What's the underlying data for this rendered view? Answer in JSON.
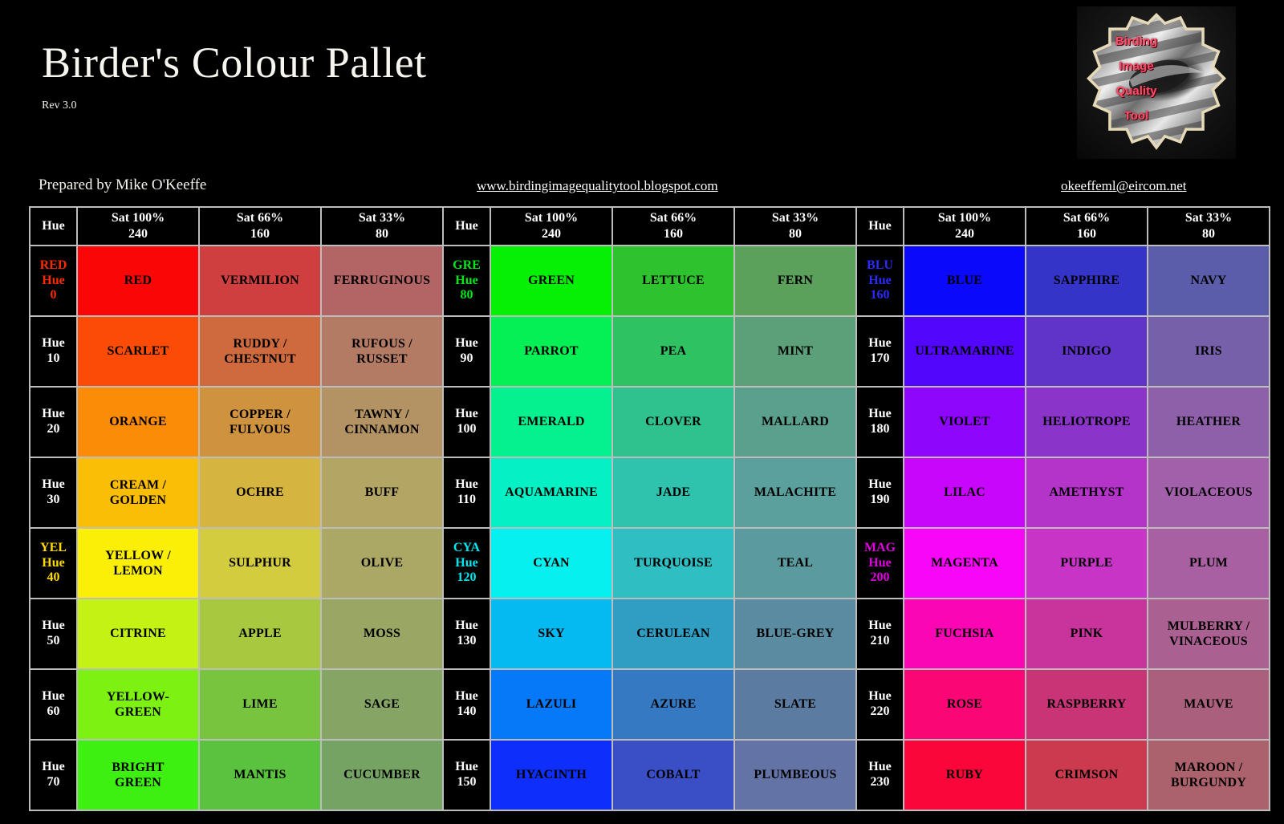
{
  "header": {
    "title": "Birder's Colour Pallet",
    "revision": "Rev 3.0",
    "prepared_by": "Prepared by Mike O'Keeffe",
    "blog_url": "www.birdingimagequalitytool.blogspot.com",
    "email": "okeeffeml@eircom.net"
  },
  "logo": {
    "name": "birding-image-quality-tool-logo",
    "words": [
      "Birding",
      "Image",
      "Quality",
      "Tool"
    ],
    "text_color": "#ff4d6a",
    "gear_outline_color": "#e6d9b8"
  },
  "table": {
    "headers": [
      "Hue",
      "Sat 100%",
      "240",
      "Sat 66%",
      "160",
      "Sat 33%",
      "80"
    ],
    "hue_header": "Hue",
    "sat_headers": [
      {
        "pct": "Sat 100%",
        "val": "240"
      },
      {
        "pct": "Sat 66%",
        "val": "160"
      },
      {
        "pct": "Sat 33%",
        "val": "80"
      }
    ]
  },
  "chart_data": {
    "type": "table",
    "title": "Birder's Colour Pallet",
    "description": "Colour naming reference grid: 24 hues (0-230 in steps of 10) x 3 saturation levels (240 = Sat 100%, 160 = Sat 66%, 80 = Sat 33%), laid out as three side-by-side blocks of 8 hue rows.",
    "columns": [
      "Hue",
      "Sat 100% / 240",
      "Sat 66% / 160",
      "Sat 33% / 80"
    ],
    "blocks": [
      {
        "block_index": 0,
        "rows": [
          {
            "hue_primary": "RED",
            "hue_label": "Hue",
            "hue_value": "0",
            "hue_label_color": "#ff2a00",
            "cells": [
              {
                "name": "RED",
                "color": "#fb0606"
              },
              {
                "name": "VERMILION",
                "color": "#d03f3f"
              },
              {
                "name": "FERRUGINOUS",
                "color": "#b36464"
              }
            ]
          },
          {
            "hue_primary": "",
            "hue_label": "Hue",
            "hue_value": "10",
            "hue_label_color": "#ffffff",
            "cells": [
              {
                "name": "SCARLET",
                "color": "#fb4b07"
              },
              {
                "name": "RUDDY / CHESTNUT",
                "color": "#cf6a3f"
              },
              {
                "name": "RUFOUS / RUSSET",
                "color": "#b37a64"
              }
            ]
          },
          {
            "hue_primary": "",
            "hue_label": "Hue",
            "hue_value": "20",
            "hue_label_color": "#ffffff",
            "cells": [
              {
                "name": "ORANGE",
                "color": "#fb8c07"
              },
              {
                "name": "COPPER / FULVOUS",
                "color": "#cf923f"
              },
              {
                "name": "TAWNY / CINNAMON",
                "color": "#b39264"
              }
            ]
          },
          {
            "hue_primary": "",
            "hue_label": "Hue",
            "hue_value": "30",
            "hue_label_color": "#ffffff",
            "cells": [
              {
                "name": "CREAM / GOLDEN",
                "color": "#fbbe07"
              },
              {
                "name": "OCHRE",
                "color": "#d5b53f"
              },
              {
                "name": "BUFF",
                "color": "#b3a564"
              }
            ]
          },
          {
            "hue_primary": "YEL",
            "hue_label": "Hue",
            "hue_value": "40",
            "hue_label_color": "#ffd900",
            "cells": [
              {
                "name": "YELLOW / LEMON",
                "color": "#fbee07"
              },
              {
                "name": "SULPHUR",
                "color": "#d4cc3f"
              },
              {
                "name": "OLIVE",
                "color": "#aba764"
              }
            ]
          },
          {
            "hue_primary": "",
            "hue_label": "Hue",
            "hue_value": "50",
            "hue_label_color": "#ffffff",
            "cells": [
              {
                "name": "CITRINE",
                "color": "#c4f215"
              },
              {
                "name": "APPLE",
                "color": "#a8c83f"
              },
              {
                "name": "MOSS",
                "color": "#9aa764"
              }
            ]
          },
          {
            "hue_primary": "",
            "hue_label": "Hue",
            "hue_value": "60",
            "hue_label_color": "#ffffff",
            "cells": [
              {
                "name": "YELLOW-GREEN",
                "color": "#7cf112"
              },
              {
                "name": "LIME",
                "color": "#79c43f"
              },
              {
                "name": "SAGE",
                "color": "#86a464"
              }
            ]
          },
          {
            "hue_primary": "",
            "hue_label": "Hue",
            "hue_value": "70",
            "hue_label_color": "#ffffff",
            "cells": [
              {
                "name": "BRIGHT GREEN",
                "color": "#3ef011"
              },
              {
                "name": "MANTIS",
                "color": "#5ac23f"
              },
              {
                "name": "CUCUMBER",
                "color": "#74a364"
              }
            ]
          }
        ]
      },
      {
        "block_index": 1,
        "rows": [
          {
            "hue_primary": "GRE",
            "hue_label": "Hue",
            "hue_value": "80",
            "hue_label_color": "#00e81b",
            "cells": [
              {
                "name": "GREEN",
                "color": "#05f005"
              },
              {
                "name": "LETTUCE",
                "color": "#2fc22f"
              },
              {
                "name": "FERN",
                "color": "#5ba05b"
              }
            ]
          },
          {
            "hue_primary": "",
            "hue_label": "Hue",
            "hue_value": "90",
            "hue_label_color": "#ffffff",
            "cells": [
              {
                "name": "PARROT",
                "color": "#05f055"
              },
              {
                "name": "PEA",
                "color": "#2fc263"
              },
              {
                "name": "MINT",
                "color": "#5ba078"
              }
            ]
          },
          {
            "hue_primary": "",
            "hue_label": "Hue",
            "hue_value": "100",
            "hue_label_color": "#ffffff",
            "cells": [
              {
                "name": "EMERALD",
                "color": "#05f08f"
              },
              {
                "name": "CLOVER",
                "color": "#2fc28f"
              },
              {
                "name": "MALLARD",
                "color": "#5ba08d"
              }
            ]
          },
          {
            "hue_primary": "",
            "hue_label": "Hue",
            "hue_value": "110",
            "hue_label_color": "#ffffff",
            "cells": [
              {
                "name": "AQUAMARINE",
                "color": "#05f0c4"
              },
              {
                "name": "JADE",
                "color": "#2fc2ad"
              },
              {
                "name": "MALACHITE",
                "color": "#5ba09d"
              }
            ]
          },
          {
            "hue_primary": "CYA",
            "hue_label": "Hue",
            "hue_value": "120",
            "hue_label_color": "#00e5ef",
            "cells": [
              {
                "name": "CYAN",
                "color": "#05f0ee"
              },
              {
                "name": "TURQUOISE",
                "color": "#2fbec2"
              },
              {
                "name": "TEAL",
                "color": "#5b9ba0"
              }
            ]
          },
          {
            "hue_primary": "",
            "hue_label": "Hue",
            "hue_value": "130",
            "hue_label_color": "#ffffff",
            "cells": [
              {
                "name": "SKY",
                "color": "#05baf0"
              },
              {
                "name": "CERULEAN",
                "color": "#2f9ec2"
              },
              {
                "name": "BLUE-GREY",
                "color": "#5b8ba0"
              }
            ]
          },
          {
            "hue_primary": "",
            "hue_label": "Hue",
            "hue_value": "140",
            "hue_label_color": "#ffffff",
            "cells": [
              {
                "name": "LAZULI",
                "color": "#0679f9"
              },
              {
                "name": "AZURE",
                "color": "#3479c2"
              },
              {
                "name": "SLATE",
                "color": "#5b7ca0"
              }
            ]
          },
          {
            "hue_primary": "",
            "hue_label": "Hue",
            "hue_value": "150",
            "hue_label_color": "#ffffff",
            "cells": [
              {
                "name": "HYACINTH",
                "color": "#0e2ffb"
              },
              {
                "name": "COBALT",
                "color": "#3a4fc5"
              },
              {
                "name": "PLUMBEOUS",
                "color": "#6373a6"
              }
            ]
          }
        ]
      },
      {
        "block_index": 2,
        "rows": [
          {
            "hue_primary": "BLU",
            "hue_label": "Hue",
            "hue_value": "160",
            "hue_label_color": "#2b2bff",
            "cells": [
              {
                "name": "BLUE",
                "color": "#0a09fb"
              },
              {
                "name": "SAPPHIRE",
                "color": "#3434c9"
              },
              {
                "name": "NAVY",
                "color": "#5c5daa"
              }
            ]
          },
          {
            "hue_primary": "",
            "hue_label": "Hue",
            "hue_value": "170",
            "hue_label_color": "#ffffff",
            "cells": [
              {
                "name": "ULTRAMARINE",
                "color": "#5206fb"
              },
              {
                "name": "INDIGO",
                "color": "#6034c9"
              },
              {
                "name": "IRIS",
                "color": "#7760aa"
              }
            ]
          },
          {
            "hue_primary": "",
            "hue_label": "Hue",
            "hue_value": "180",
            "hue_label_color": "#ffffff",
            "cells": [
              {
                "name": "VIOLET",
                "color": "#8e06fb"
              },
              {
                "name": "HELIOTROPE",
                "color": "#8b34c9"
              },
              {
                "name": "HEATHER",
                "color": "#8f60aa"
              }
            ]
          },
          {
            "hue_primary": "",
            "hue_label": "Hue",
            "hue_value": "190",
            "hue_label_color": "#ffffff",
            "cells": [
              {
                "name": "LILAC",
                "color": "#c806fb"
              },
              {
                "name": "AMETHYST",
                "color": "#b434c9"
              },
              {
                "name": "VIOLACEOUS",
                "color": "#a260aa"
              }
            ]
          },
          {
            "hue_primary": "MAG",
            "hue_label": "Hue",
            "hue_value": "200",
            "hue_label_color": "#e000e0",
            "cells": [
              {
                "name": "MAGENTA",
                "color": "#f706f7"
              },
              {
                "name": "PURPLE",
                "color": "#c734c6"
              },
              {
                "name": "PLUM",
                "color": "#a860a2"
              }
            ]
          },
          {
            "hue_primary": "",
            "hue_label": "Hue",
            "hue_value": "210",
            "hue_label_color": "#ffffff",
            "cells": [
              {
                "name": "FUCHSIA",
                "color": "#fb06b5"
              },
              {
                "name": "PINK",
                "color": "#c9349c"
              },
              {
                "name": "MULBERRY / VINACEOUS",
                "color": "#aa6090"
              }
            ]
          },
          {
            "hue_primary": "",
            "hue_label": "Hue",
            "hue_value": "220",
            "hue_label_color": "#ffffff",
            "cells": [
              {
                "name": "ROSE",
                "color": "#fb0675"
              },
              {
                "name": "RASPBERRY",
                "color": "#c93476"
              },
              {
                "name": "MAUVE",
                "color": "#aa607c"
              }
            ]
          },
          {
            "hue_primary": "",
            "hue_label": "Hue",
            "hue_value": "230",
            "hue_label_color": "#ffffff",
            "cells": [
              {
                "name": "RUBY",
                "color": "#fb063a"
              },
              {
                "name": "CRIMSON",
                "color": "#cb3a4f"
              },
              {
                "name": "MAROON / BURGUNDY",
                "color": "#ac626c"
              }
            ]
          }
        ]
      }
    ]
  }
}
